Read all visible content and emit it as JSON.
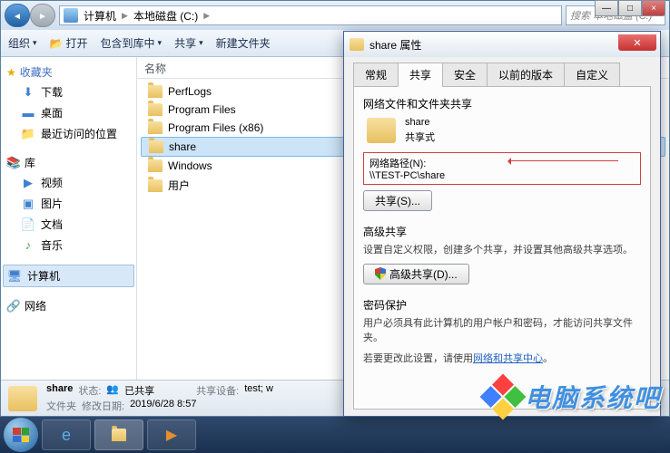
{
  "window": {
    "min": "—",
    "max": "□",
    "close": "×"
  },
  "breadcrumb": {
    "computer": "计算机",
    "drive": "本地磁盘 (C:)"
  },
  "search": {
    "placeholder": "搜索 本地磁盘 (C:)"
  },
  "toolbar": {
    "organize": "组织",
    "open": "打开",
    "include": "包含到库中",
    "share": "共享",
    "new_folder": "新建文件夹"
  },
  "sidebar": {
    "favorites": {
      "label": "收藏夹",
      "items": [
        "下载",
        "桌面",
        "最近访问的位置"
      ]
    },
    "libraries": {
      "label": "库",
      "items": [
        "视频",
        "图片",
        "文档",
        "音乐"
      ]
    },
    "computer": "计算机",
    "network": "网络"
  },
  "content": {
    "col_name": "名称",
    "items": [
      "PerfLogs",
      "Program Files",
      "Program Files (x86)",
      "share",
      "Windows",
      "用户"
    ],
    "selected_index": 3
  },
  "details": {
    "name": "share",
    "type": "文件夹",
    "status_label": "状态:",
    "status_value": "已共享",
    "modified_label": "修改日期:",
    "modified_value": "2019/6/28 8:57",
    "share_device_label": "共享设备:",
    "share_device_value": "test; w"
  },
  "dialog": {
    "title": "share 属性",
    "tabs": [
      "常规",
      "共享",
      "安全",
      "以前的版本",
      "自定义"
    ],
    "active_tab": 1,
    "section1": {
      "title": "网络文件和文件夹共享",
      "name": "share",
      "mode": "共享式",
      "path_label": "网络路径(N):",
      "path_value": "\\\\TEST-PC\\share",
      "share_btn": "共享(S)..."
    },
    "section2": {
      "title": "高级共享",
      "desc": "设置自定义权限，创建多个共享，并设置其他高级共享选项。",
      "btn": "高级共享(D)..."
    },
    "section3": {
      "title": "密码保护",
      "desc1": "用户必须具有此计算机的用户帐户和密码，才能访问共享文件夹。",
      "desc2_pre": "若要更改此设置，请使用",
      "link": "网络和共享中心",
      "desc2_post": "。"
    }
  },
  "watermark": "电脑系统吧"
}
